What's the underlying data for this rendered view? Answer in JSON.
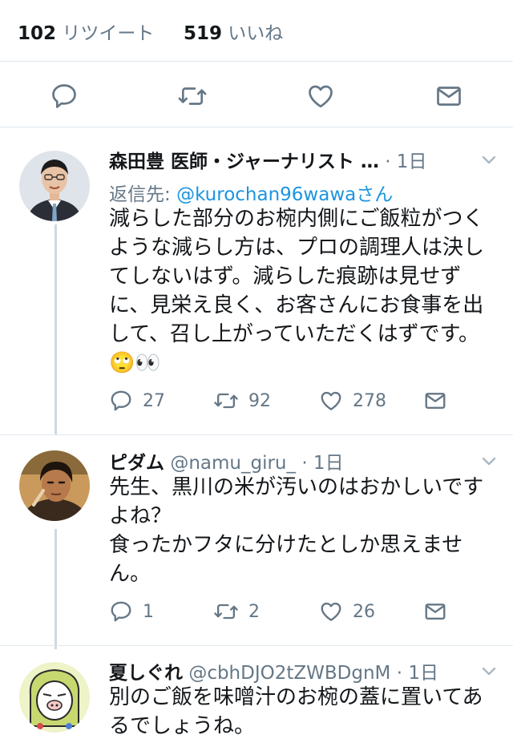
{
  "stats": {
    "retweet_count": "102",
    "retweet_label": "リツイート",
    "like_count": "519",
    "like_label": "いいね"
  },
  "icons": {
    "reply": "reply-icon",
    "retweet": "retweet-icon",
    "like": "heart-icon",
    "dm": "dm-icon",
    "caret": "chevron-down-icon"
  },
  "colors": {
    "link": "#1b95e0",
    "muted": "#657786",
    "icon": "#657786",
    "divider": "#e1e8ed"
  },
  "replies": [
    {
      "name": "森田豊 医師・ジャーナリスト …",
      "handle": "",
      "time": "· 1日",
      "reply_to_label": "返信先: ",
      "reply_to_handle": "@kurochan96wawaさん",
      "text": "減らした部分のお椀内側にご飯粒がつくような減らし方は、プロの調理人は決してしないはず。減らした痕跡は見せずに、見栄え良く、お客さんにお食事を出して、召し上がっていただくはずです。\n🙄👀",
      "reply_count": "27",
      "retweet_count": "92",
      "like_count": "278"
    },
    {
      "name": "ピダム",
      "handle": "@namu_giru_",
      "time": "· 1日",
      "text": "先生、黒川の米が汚いのはおかしいですよね？\n食ったかフタに分けたとしか思えません。",
      "reply_count": "1",
      "retweet_count": "2",
      "like_count": "26"
    },
    {
      "name": "夏しぐれ",
      "handle": "@cbhDJO2tZWBDgnM",
      "time": "· 1日",
      "text": "別のご飯を味噌汁のお椀の蓋に置いてあるでしょうね。"
    }
  ]
}
